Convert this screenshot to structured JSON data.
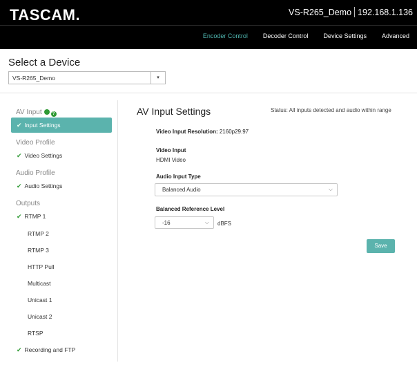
{
  "header": {
    "logo": "TASCAM",
    "logo_dot": ".",
    "device_name": "VS-R265_Demo",
    "ip_address": "192.168.1.136"
  },
  "nav": [
    {
      "label": "Encoder Control",
      "active": true
    },
    {
      "label": "Decoder Control",
      "active": false
    },
    {
      "label": "Device Settings",
      "active": false
    },
    {
      "label": "Advanced",
      "active": false
    }
  ],
  "device_picker": {
    "title": "Select a Device",
    "selected": "VS-R265_Demo",
    "button_glyph": "▾"
  },
  "sidebar": {
    "groups": {
      "av_input": "AV Input",
      "video_profile": "Video Profile",
      "audio_profile": "Audio Profile",
      "outputs": "Outputs"
    },
    "items": {
      "input_settings": "Input Settings",
      "video_settings": "Video Settings",
      "audio_settings": "Audio Settings",
      "rtmp1": "RTMP 1",
      "rtmp2": "RTMP 2",
      "rtmp3": "RTMP 3",
      "http_pull": "HTTP Pull",
      "multicast": "Multicast",
      "unicast1": "Unicast 1",
      "unicast2": "Unicast 2",
      "rtsp": "RTSP",
      "recording_ftp": "Recording and FTP"
    },
    "check_glyph": "✔",
    "help_glyph": "?"
  },
  "main": {
    "title": "AV Input Settings",
    "status": "Status: All inputs detected and audio within range",
    "video_input_resolution_label": "Video Input Resolution:",
    "video_input_resolution_value": "2160p29.97",
    "video_input_label": "Video Input",
    "video_input_value": "HDMI Video",
    "audio_input_type_label": "Audio Input Type",
    "audio_input_type_value": "Balanced Audio",
    "balanced_ref_label": "Balanced Reference Level",
    "balanced_ref_value": "-16",
    "balanced_ref_unit": "dBFS",
    "save_label": "Save",
    "chevron_glyph": "⌵"
  },
  "colors": {
    "accent": "#5bb3ad",
    "nav_active": "#4fb6b0",
    "check_green": "#2f9a34",
    "header_bg": "#000000"
  }
}
